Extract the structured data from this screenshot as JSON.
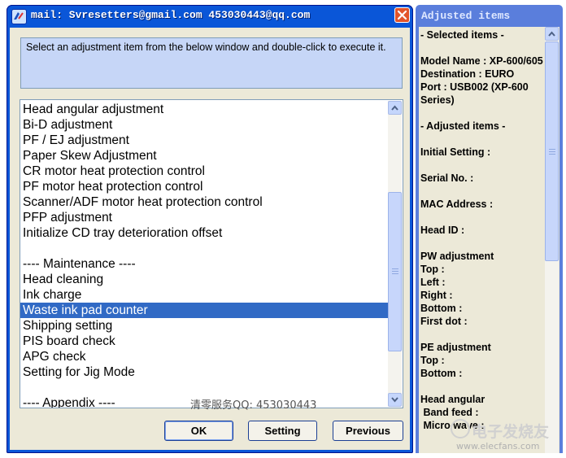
{
  "window": {
    "title": "mail: Svresetters@gmail.com  453030443@qq.com"
  },
  "instruction": {
    "text": "Select an adjustment item from the below window and double-click to execute it."
  },
  "list": {
    "items": [
      "Head angular adjustment",
      "Bi-D adjustment",
      "PF / EJ adjustment",
      "Paper Skew Adjustment",
      "CR motor heat protection control",
      "PF motor heat protection control",
      "Scanner/ADF motor heat protection control",
      "PFP adjustment",
      "Initialize CD tray deterioration offset",
      "",
      "---- Maintenance ----",
      "Head cleaning",
      "Ink charge",
      "Waste ink pad counter",
      "Shipping setting",
      "PIS board check",
      "APG check",
      "Setting for Jig Mode",
      "",
      "---- Appendix ----"
    ],
    "selected": "Waste ink pad counter"
  },
  "watermark": {
    "cn_text": "清零服务QQ: 453030443",
    "site_text": "www.elecfans.com",
    "site_cn": "电子发烧友"
  },
  "buttons": {
    "ok": "OK",
    "setting": "Setting",
    "previous": "Previous"
  },
  "side_panel": {
    "title": "Adjusted items",
    "lines": [
      "- Selected items -",
      "",
      "Model Name : XP-600/605",
      "Destination : EURO",
      "Port : USB002 (XP-600 Series)",
      "",
      "- Adjusted items -",
      "",
      "Initial Setting :",
      "",
      "Serial No. :",
      "",
      "MAC Address :",
      "",
      "Head ID :",
      "",
      "PW adjustment",
      "Top :",
      "Left :",
      "Right :",
      "Bottom :",
      "First dot :",
      "",
      "PE adjustment",
      "Top :",
      "Bottom :",
      "",
      "Head angular",
      " Band feed :",
      " Micro wave :"
    ]
  },
  "colors": {
    "titlebar": "#0a56d8",
    "close": "#e2542a",
    "selection": "#316ac5",
    "instruction_bg": "#c6d6f7",
    "side_titlebar": "#5a7edc"
  }
}
